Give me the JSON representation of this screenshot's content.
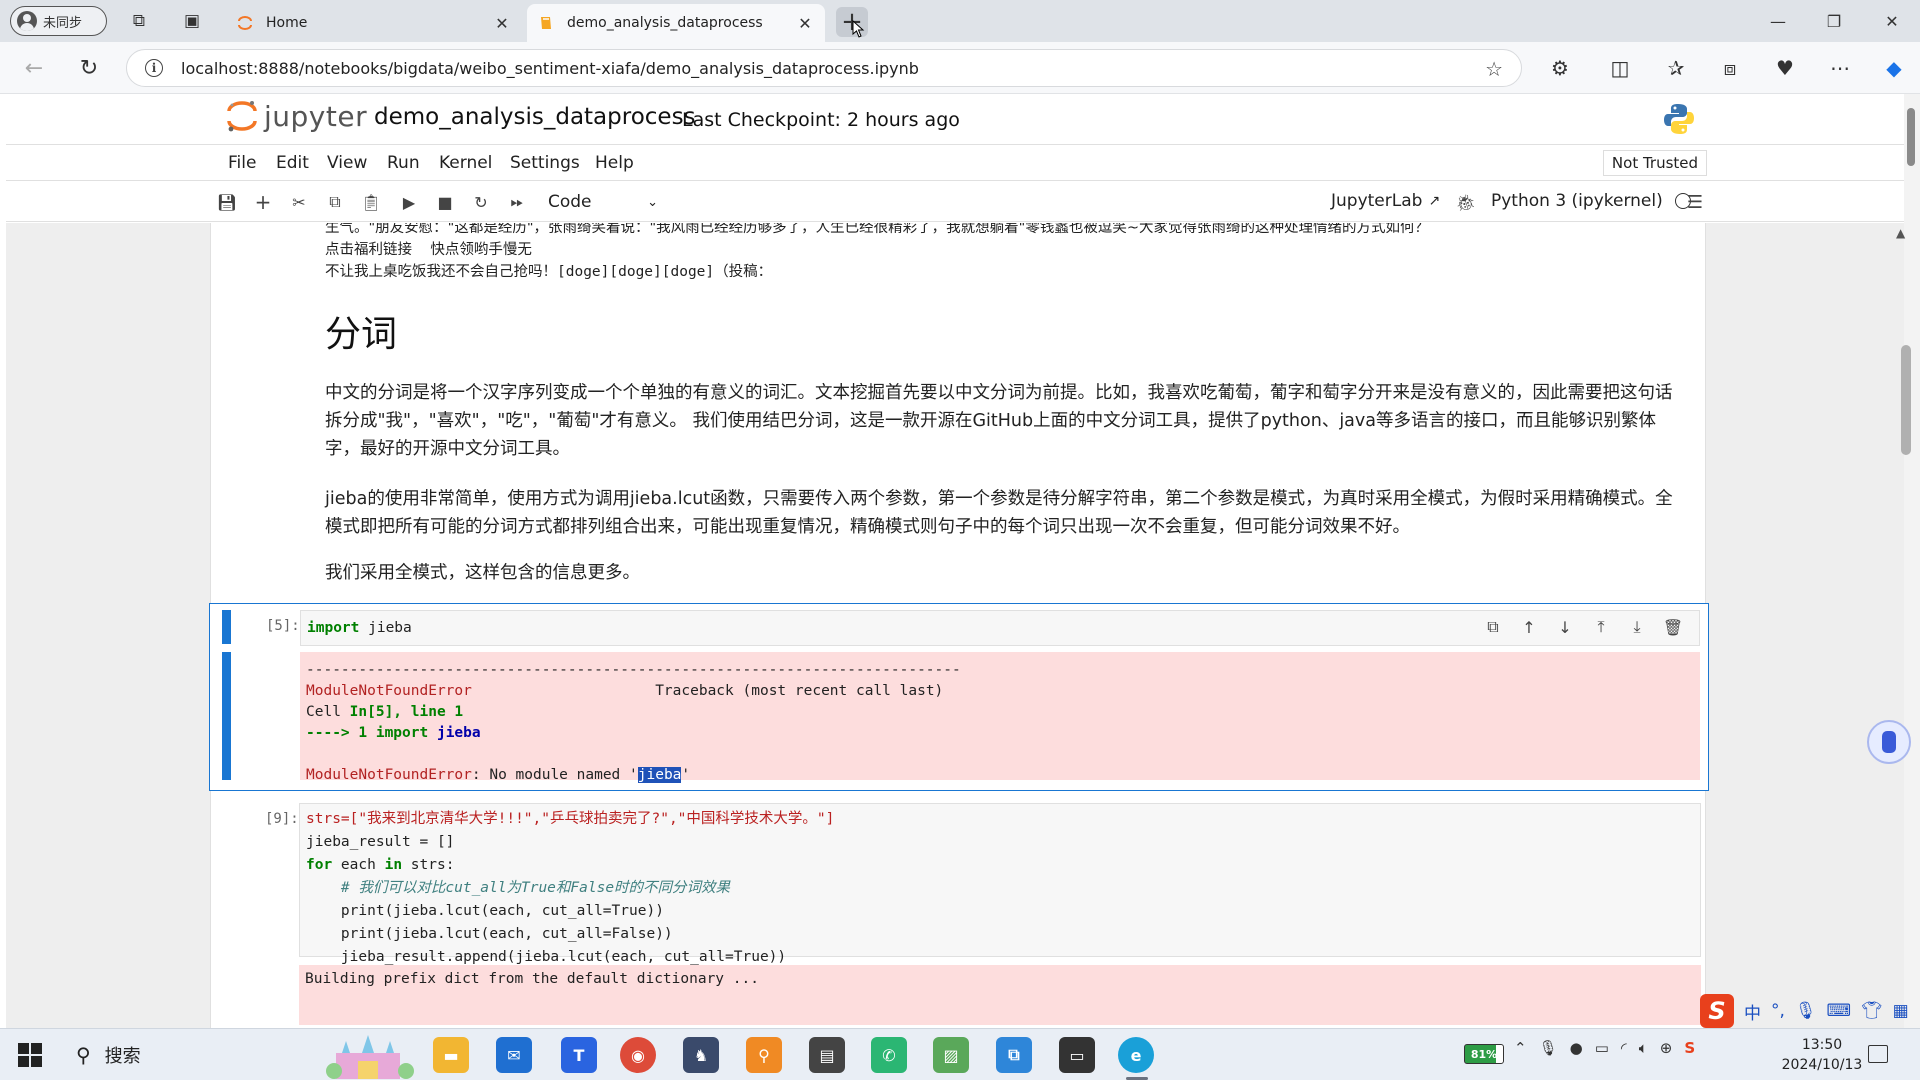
{
  "browser": {
    "profile_label": "未同步",
    "tabs": [
      {
        "title": "Home",
        "active": false
      },
      {
        "title": "demo_analysis_dataprocess",
        "active": true
      }
    ],
    "url": "localhost:8888/notebooks/bigdata/weibo_sentiment-xiafa/demo_analysis_dataprocess.ipynb"
  },
  "jupyter": {
    "logo_text": "jupyter",
    "notebook_name": "demo_analysis_dataprocess",
    "checkpoint": "Last Checkpoint: 2 hours ago",
    "menu": [
      "File",
      "Edit",
      "View",
      "Run",
      "Kernel",
      "Settings",
      "Help"
    ],
    "trust_status": "Not Trusted",
    "cell_type": "Code",
    "jupyterlab_link": "JupyterLab",
    "kernel_name": "Python 3 (ipykernel)"
  },
  "notebook": {
    "prev_output_tail": [
      "生气。\"朋友安慰：\"这都是经历\"，张雨绮笑着说：\"我风雨已经经历够多了，人生已经很精彩了，我就想躺着\"零钱蠡也被逗笑~大家觉得张雨绮的这种处理情绪的方式如何？",
      "点击福利链接    快点领哟手慢无",
      "不让我上桌吃饭我还不会自己抢吗！[doge][doge][doge]（投稿："
    ],
    "heading": "分词",
    "paragraphs": [
      "中文的分词是将一个汉字序列变成一个个单独的有意义的词汇。文本挖掘首先要以中文分词为前提。比如，我喜欢吃葡萄，葡字和萄字分开来是没有意义的，因此需要把这句话拆分成\"我\"，\"喜欢\"，\"吃\"，\"葡萄\"才有意义。 我们使用结巴分词，这是一款开源在GitHub上面的中文分词工具，提供了python、java等多语言的接口，而且能够识别繁体字，最好的开源中文分词工具。",
      "jieba的使用非常简单，使用方式为调用jieba.lcut函数，只需要传入两个参数，第一个参数是待分解字符串，第二个参数是模式，为真时采用全模式，为假时采用精确模式。全模式即把所有可能的分词方式都排列组合出来，可能出现重复情况，精确模式则句子中的每个词只出现一次不会重复，但可能分词效果不好。",
      "我们采用全模式，这样包含的信息更多。"
    ],
    "cell5": {
      "prompt": "[5]:",
      "code_kw": "import",
      "code_rest": " jieba",
      "error": {
        "rule": "---------------------------------------------------------------------------",
        "name": "ModuleNotFoundError",
        "traceback": "Traceback (most recent call last)",
        "cell_prefix": "Cell ",
        "cell_ref": "In[5], line 1",
        "arrow": "----> 1 ",
        "arrow_kw": "import",
        "arrow_mod": "jieba",
        "final_name": "ModuleNotFoundError",
        "final_msg": ": No module named '",
        "final_mod": "jieba",
        "final_end": "'"
      }
    },
    "cell9": {
      "prompt": "[9]:",
      "line1": "strs=[\"我来到北京清华大学!!!\",\"乒乓球拍卖完了?\",\"中国科学技术大学。\"]",
      "line2": "jieba_result = []",
      "line3_kw1": "for",
      "line3_mid": " each ",
      "line3_kw2": "in",
      "line3_end": " strs:",
      "line4": "    # 我们可以对比cut_all为True和False时的不同分词效果",
      "line5": "    print(jieba.lcut(each, cut_all=True))",
      "line6": "    print(jieba.lcut(each, cut_all=False))",
      "line7": "    jieba_result.append(jieba.lcut(each, cut_all=True))",
      "output": "Building prefix dict from the default dictionary ..."
    }
  },
  "ime": {
    "chinese_mode": "中",
    "punct": "°,"
  },
  "taskbar": {
    "search_label": "搜索",
    "battery": "81%",
    "time": "13:50",
    "date": "2024/10/13"
  },
  "colors": {
    "accent": "#1976d2",
    "error_bg": "#fddddd",
    "jupyter_orange": "#f37726"
  }
}
